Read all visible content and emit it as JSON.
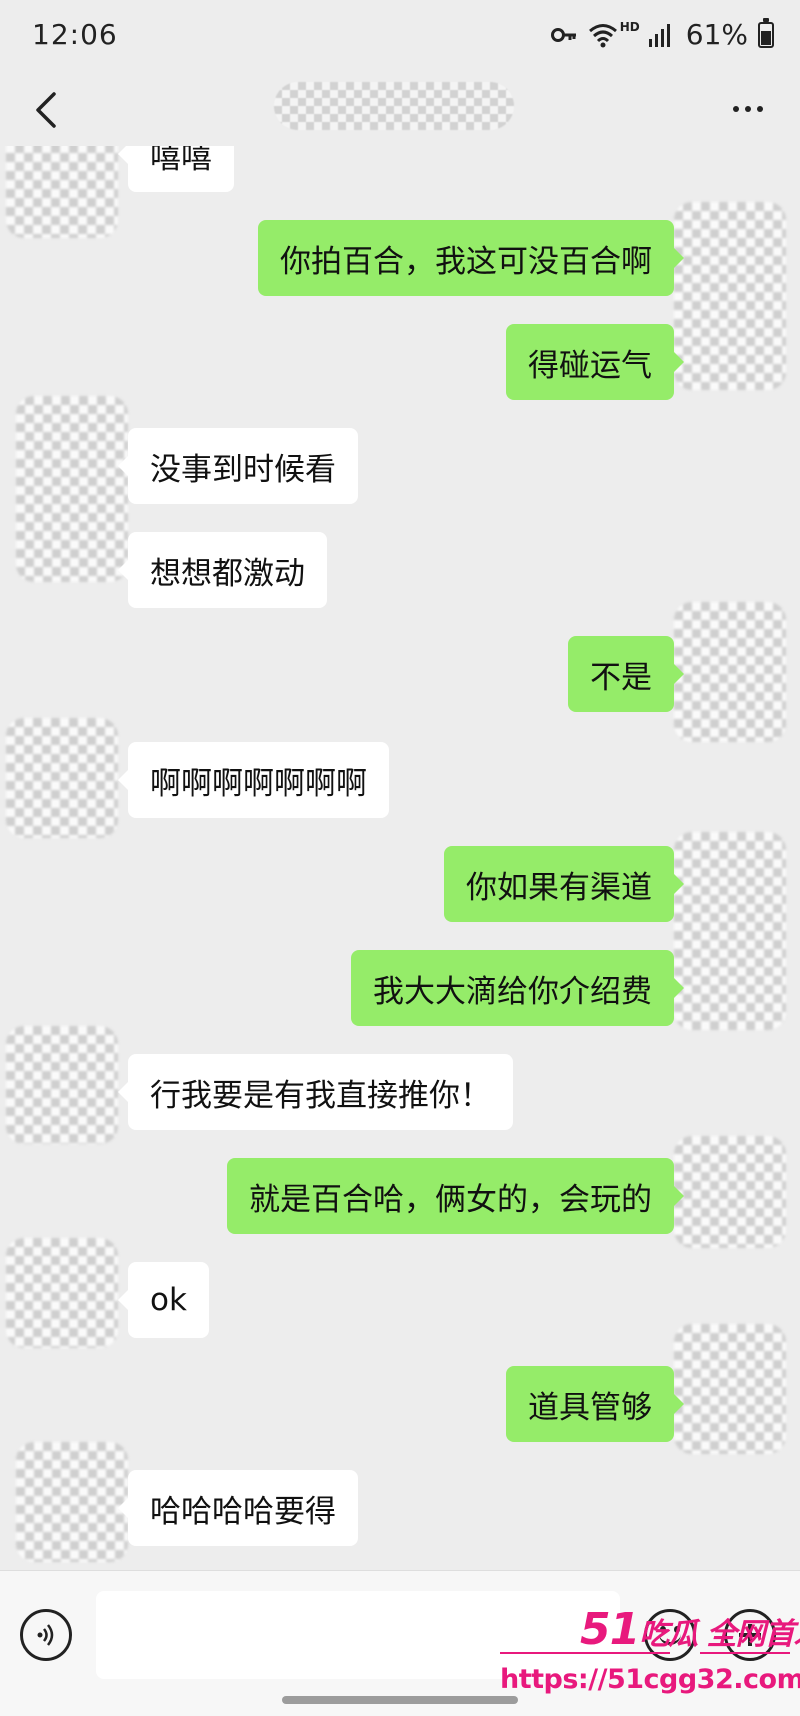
{
  "status_bar": {
    "time": "12:06",
    "network_label": "HD",
    "battery": "61%",
    "battery_level": 0.61,
    "icons": [
      "key-icon",
      "wifi-icon",
      "signal-icon",
      "battery-icon"
    ]
  },
  "header": {
    "title": "",
    "back_icon": "chevron-left-icon",
    "more_icon": "more-dots-icon"
  },
  "messages": [
    {
      "direction": "in",
      "text": "嘻嘻"
    },
    {
      "direction": "out",
      "text": "你拍百合，我这可没百合啊"
    },
    {
      "direction": "out",
      "text": "得碰运气"
    },
    {
      "direction": "in",
      "text": "没事到时候看"
    },
    {
      "direction": "in",
      "text": "想想都激动"
    },
    {
      "direction": "out",
      "text": "不是"
    },
    {
      "direction": "in",
      "text": "啊啊啊啊啊啊啊"
    },
    {
      "direction": "out",
      "text": "你如果有渠道"
    },
    {
      "direction": "out",
      "text": "我大大滴给你介绍费"
    },
    {
      "direction": "in",
      "text": "行我要是有我直接推你！"
    },
    {
      "direction": "out",
      "text": "就是百合哈，俩女的，会玩的"
    },
    {
      "direction": "in",
      "text": "ok"
    },
    {
      "direction": "out",
      "text": "道具管够"
    },
    {
      "direction": "in",
      "text": "哈哈哈哈要得"
    }
  ],
  "input_bar": {
    "voice_icon": "voice-icon",
    "input_value": "",
    "emoji_icon": "emoji-icon",
    "plus_icon": "plus-icon"
  },
  "watermark": {
    "line1_num": "51",
    "line1_text": "吃瓜 全网首发",
    "line2": "https://51cgg32.com"
  },
  "colors": {
    "background": "#ededed",
    "bubble_out": "#95ec69",
    "bubble_in": "#ffffff",
    "watermark": "#e8197d"
  }
}
